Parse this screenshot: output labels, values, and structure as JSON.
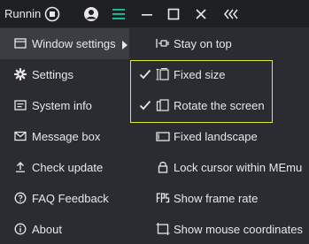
{
  "titlebar": {
    "app_title": "Runnin",
    "icons": [
      "stop-icon",
      "account-icon",
      "menu-icon",
      "minimize-icon",
      "maximize-icon",
      "close-icon",
      "collapse-sidebar-icon"
    ],
    "accent_color": "#25c2a0"
  },
  "main_menu": {
    "items": [
      {
        "label": "Window settings",
        "icon": "window-icon",
        "has_submenu": true,
        "active": true
      },
      {
        "label": "Settings",
        "icon": "gear-icon"
      },
      {
        "label": "System info",
        "icon": "system-info-icon"
      },
      {
        "label": "Message box",
        "icon": "envelope-icon"
      },
      {
        "label": "Check update",
        "icon": "upload-arrow-icon"
      },
      {
        "label": "FAQ  Feedback",
        "icon": "help-icon"
      },
      {
        "label": "About",
        "icon": "about-icon"
      }
    ]
  },
  "window_settings_menu": {
    "items": [
      {
        "label": "Stay on top",
        "icon": "pin-icon",
        "checked": false
      },
      {
        "label": "Fixed size",
        "icon": "fixed-size-icon",
        "checked": true
      },
      {
        "label": "Rotate the screen",
        "icon": "rotate-screen-icon",
        "checked": true
      },
      {
        "label": "Fixed landscape",
        "icon": "landscape-icon",
        "checked": false
      },
      {
        "label": "Lock cursor within MEmu",
        "icon": "lock-icon",
        "checked": false
      },
      {
        "label": "Show frame rate",
        "icon": "fps-icon",
        "checked": false
      },
      {
        "label": "Show mouse coordinates",
        "icon": "coordinates-icon",
        "checked": false
      }
    ],
    "highlight_color": "#e3ea3c"
  }
}
